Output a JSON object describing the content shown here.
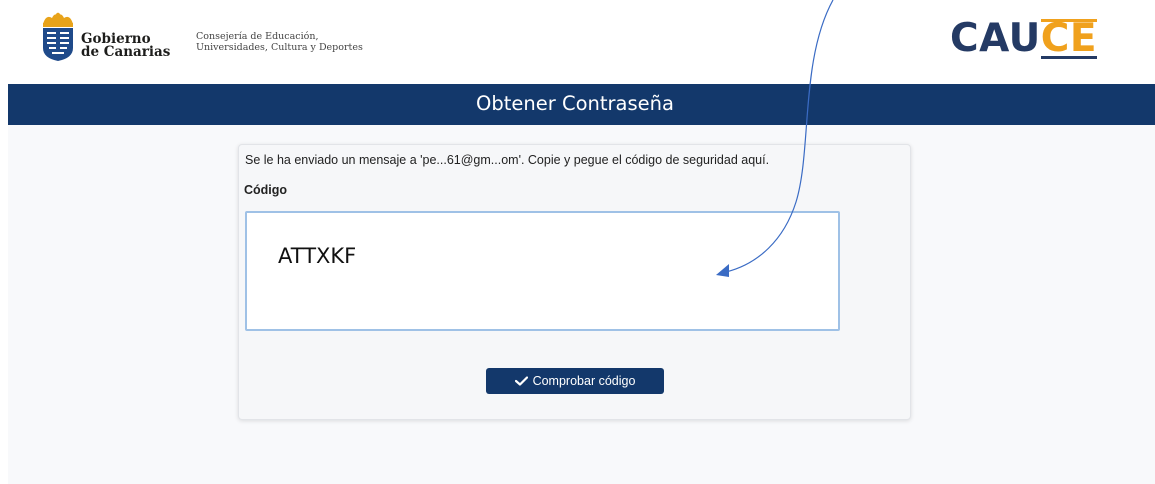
{
  "header": {
    "gov_name_line1": "Gobierno",
    "gov_name_line2": "de Canarias",
    "consejeria_line1": "Consejería de Educación,",
    "consejeria_line2": "Universidades, Cultura y Deportes",
    "cauce_main": "CAU",
    "cauce_accent": "CE"
  },
  "page": {
    "title": "Obtener Contraseña"
  },
  "form": {
    "message": "Se le ha enviado un mensaje a 'pe...61@gm...om'. Copie y pegue el código de seguridad aquí.",
    "code_label": "Código",
    "code_value": "ATTXKF",
    "submit_label": "Comprobar código",
    "submit_icon": "check-icon"
  },
  "colors": {
    "navy": "#13386b",
    "cauce_accent": "#f0a11d",
    "input_border": "#9fc1e6",
    "annotation_arrow": "#3a6bc4"
  }
}
